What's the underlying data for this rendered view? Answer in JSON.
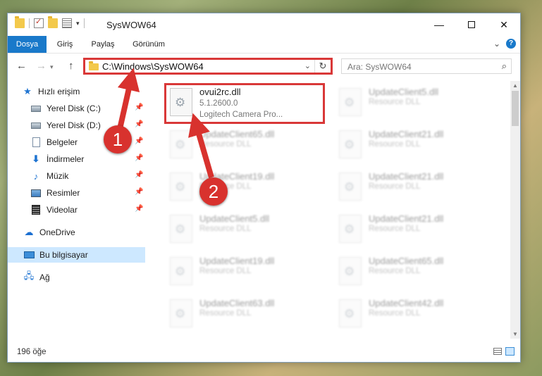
{
  "window": {
    "title": "SysWOW64",
    "controls": {
      "minimize": "—",
      "maximize": "",
      "close": "✕"
    }
  },
  "ribbon": {
    "tabs": [
      "Dosya",
      "Giriş",
      "Paylaş",
      "Görünüm"
    ],
    "help": "?"
  },
  "address": {
    "path": "C:\\Windows\\SysWOW64",
    "search_placeholder": "Ara: SysWOW64"
  },
  "sidebar": {
    "items": [
      {
        "label": "Hızlı erişim",
        "icon": "star-icon",
        "pinned": false
      },
      {
        "label": "Yerel Disk (C:)",
        "icon": "disk-icon",
        "pinned": true
      },
      {
        "label": "Yerel Disk (D:)",
        "icon": "disk-icon",
        "pinned": true
      },
      {
        "label": "Belgeler",
        "icon": "document-icon",
        "pinned": true
      },
      {
        "label": "İndirmeler",
        "icon": "download-icon",
        "pinned": true
      },
      {
        "label": "Müzik",
        "icon": "music-icon",
        "pinned": true
      },
      {
        "label": "Resimler",
        "icon": "picture-icon",
        "pinned": true
      },
      {
        "label": "Videolar",
        "icon": "video-icon",
        "pinned": true
      },
      {
        "label": "OneDrive",
        "icon": "cloud-icon",
        "pinned": false
      },
      {
        "label": "Bu bilgisayar",
        "icon": "computer-icon",
        "pinned": false
      },
      {
        "label": "Ağ",
        "icon": "network-icon",
        "pinned": false
      }
    ]
  },
  "files": {
    "highlighted": {
      "name": "ovui2rc.dll",
      "line1": "5.1.2600.0",
      "line2": "Logitech Camera Pro..."
    },
    "others": [
      {
        "name": "UpdateClient5.dll",
        "line1": "Resource DLL"
      },
      {
        "name": "UpdateClient65.dll",
        "line1": "Resource DLL"
      },
      {
        "name": "UpdateClient21.dll",
        "line1": "Resource DLL"
      },
      {
        "name": "UpdateClient19.dll",
        "line1": "Resource DLL"
      },
      {
        "name": "UpdateClient21.dll",
        "line1": "Resource DLL"
      },
      {
        "name": "UpdateClient5.dll",
        "line1": "Resource DLL"
      },
      {
        "name": "UpdateClient21.dll",
        "line1": "Resource DLL"
      },
      {
        "name": "UpdateClient19.dll",
        "line1": "Resource DLL"
      },
      {
        "name": "UpdateClient65.dll",
        "line1": "Resource DLL"
      },
      {
        "name": "UpdateClient63.dll",
        "line1": "Resource DLL"
      },
      {
        "name": "UpdateClient42.dll",
        "line1": "Resource DLL"
      }
    ]
  },
  "status": {
    "count": "196 öğe"
  },
  "annotations": {
    "badge1": "1",
    "badge2": "2",
    "color": "#d8322e"
  }
}
